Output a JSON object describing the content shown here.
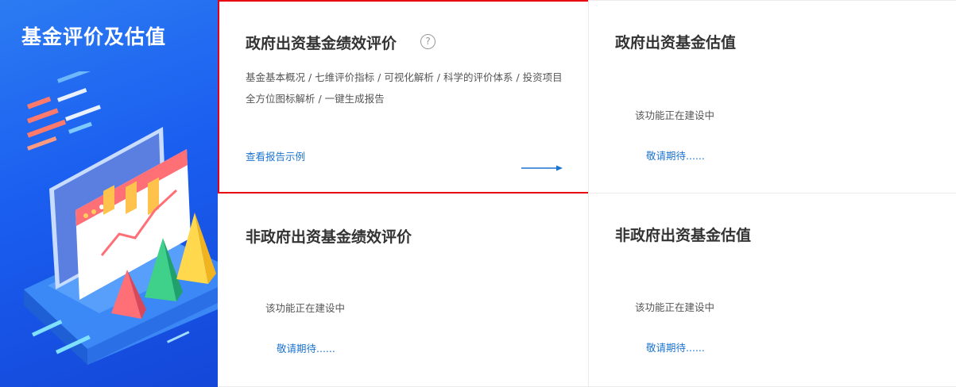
{
  "sidebar": {
    "title": "基金评价及估值",
    "illustration": "dashboard-chart-illustration"
  },
  "cards": [
    {
      "title": "政府出资基金绩效评价",
      "help_icon": "?",
      "description": "基金基本概况 / 七维评价指标 / 可视化解析 / 科学的评价体系 / 投资项目全方位图标解析 / 一键生成报告",
      "link": "查看报告示例",
      "selected": true,
      "highlight_color": "#e60012"
    },
    {
      "title": "政府出资基金估值",
      "status": "该功能正在建设中",
      "pending": "敬请期待......"
    },
    {
      "title": "非政府出资基金绩效评价",
      "status": "该功能正在建设中",
      "pending": "敬请期待......"
    },
    {
      "title": "非政府出资基金估值",
      "status": "该功能正在建设中",
      "pending": "敬请期待......"
    }
  ],
  "colors": {
    "sidebar_gradient": [
      "#2c7bf2",
      "#1447d8"
    ],
    "link": "#1c74d1",
    "border": "#ebebeb"
  }
}
